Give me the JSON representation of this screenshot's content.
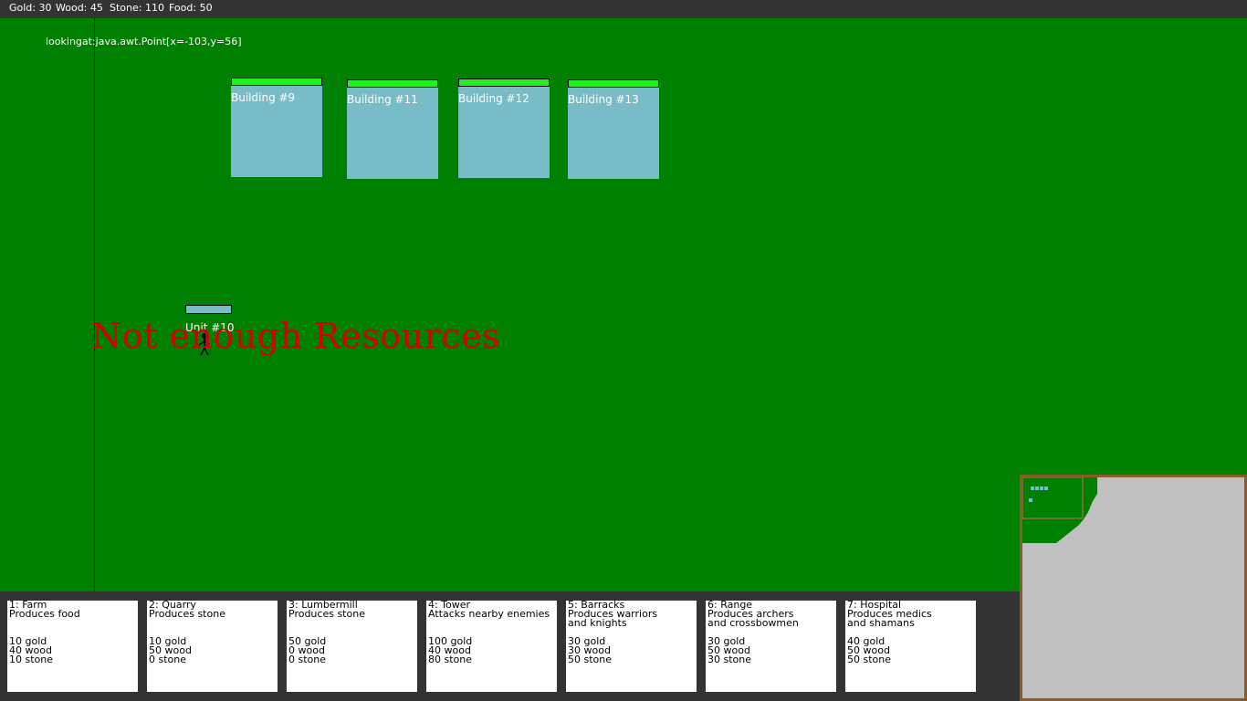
{
  "resources": {
    "gold_label": "Gold: 30",
    "wood_label": "Wood: 45",
    "stone_label": "Stone: 110",
    "food_label": "Food: 50"
  },
  "debug_text": "lookingat:java.awt.Point[x=-103,y=56]",
  "buildings": [
    {
      "name": "Building #9",
      "health_pct": 100
    },
    {
      "name": "Building #11",
      "health_pct": 100
    },
    {
      "name": "Building #12",
      "health_pct": 100
    },
    {
      "name": "Building #13",
      "health_pct": 100
    }
  ],
  "unit": {
    "name": "Unit #10",
    "health_pct": 100
  },
  "alert": "Not enough Resources",
  "build_menu": [
    {
      "title": "1: Farm",
      "desc1": "Produces food",
      "desc2": "",
      "gold": "10 gold",
      "wood": "40 wood",
      "stone": "10 stone"
    },
    {
      "title": "2: Quarry",
      "desc1": "Produces stone",
      "desc2": "",
      "gold": "10 gold",
      "wood": "50 wood",
      "stone": "0 stone"
    },
    {
      "title": "3: Lumbermill",
      "desc1": "Produces stone",
      "desc2": "",
      "gold": "50 gold",
      "wood": "0 wood",
      "stone": "0 stone"
    },
    {
      "title": "4: Tower",
      "desc1": "Attacks nearby enemies",
      "desc2": "",
      "gold": "100 gold",
      "wood": "40 wood",
      "stone": "80 stone"
    },
    {
      "title": "5: Barracks",
      "desc1": "Produces warriors",
      "desc2": "and knights",
      "gold": "30 gold",
      "wood": "30 wood",
      "stone": "50 stone"
    },
    {
      "title": "6: Range",
      "desc1": "Produces archers",
      "desc2": "and crossbowmen",
      "gold": "30 gold",
      "wood": "50 wood",
      "stone": "30 stone"
    },
    {
      "title": "7: Hospital",
      "desc1": "Produces medics",
      "desc2": "and shamans",
      "gold": "40 gold",
      "wood": "50 wood",
      "stone": "50 stone"
    }
  ],
  "colors": {
    "grass": "#008000",
    "building": "#78bcc8",
    "health_bar": "#22ee22",
    "alert": "#d40000",
    "minimap_frame": "#8b5a2b",
    "minimap_fog": "#c0c0c0"
  }
}
